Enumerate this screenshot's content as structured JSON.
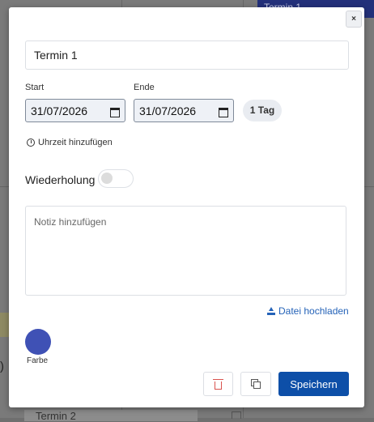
{
  "background": {
    "event_top": "Termin 1",
    "paren": ")",
    "event_bottom": "Termin 2"
  },
  "dialog": {
    "close_label": "×",
    "title_value": "Termin 1",
    "start_label": "Start",
    "start_value": "31/07/2026",
    "end_label": "Ende",
    "end_value": "31/07/2026",
    "duration_badge": "1 Tag",
    "add_time_label": "Uhrzeit hinzufügen",
    "repeat_label": "Wiederholung",
    "repeat_enabled": false,
    "note_placeholder": "Notiz hinzufügen",
    "upload_label": "Datei hochladen",
    "color_label": "Farbe",
    "color_value": "#3f51b5",
    "save_label": "Speichern"
  },
  "icons": [
    "close-icon",
    "calendar-icon",
    "clock-icon",
    "upload-icon",
    "trash-icon",
    "copy-icon"
  ],
  "colors": {
    "primary": "#0d4fa8",
    "link": "#2563b8",
    "danger": "#d9534f"
  }
}
